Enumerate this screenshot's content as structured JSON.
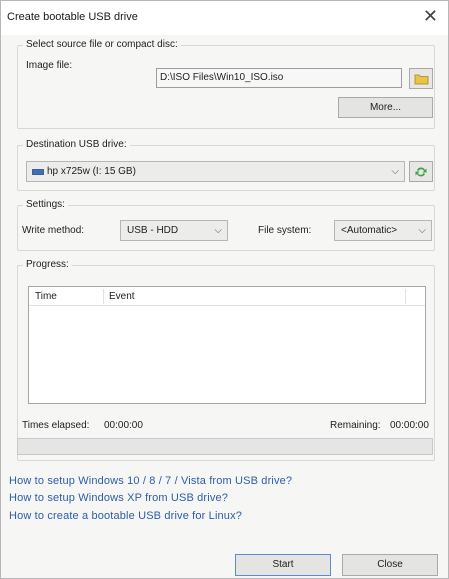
{
  "window": {
    "title": "Create bootable USB drive"
  },
  "source": {
    "legend": "Select source file or compact disc:",
    "image_label": "Image file:",
    "image_path": "D:\\ISO Files\\Win10_ISO.iso",
    "more_label": "More..."
  },
  "destination": {
    "legend": "Destination USB drive:",
    "drive": "hp x725w (I: 15 GB)"
  },
  "settings": {
    "legend": "Settings:",
    "write_method_label": "Write method:",
    "write_method_value": "USB - HDD",
    "file_system_label": "File system:",
    "file_system_value": "<Automatic>"
  },
  "progress": {
    "legend": "Progress:",
    "columns": [
      "Time",
      "Event"
    ],
    "elapsed_label": "Times elapsed:",
    "elapsed_value": "00:00:00",
    "remaining_label": "Remaining:",
    "remaining_value": "00:00:00",
    "fraction": 0
  },
  "links": [
    "How to setup Windows 10 / 8 / 7 / Vista from USB drive?",
    "How to setup Windows XP from USB drive?",
    "How to create a bootable USB drive for Linux?"
  ],
  "buttons": {
    "start": "Start",
    "close": "Close"
  },
  "colors": {
    "link": "#2d5da8",
    "folder": "#e8c544",
    "refresh": "#3aa546"
  },
  "icons": [
    "close-icon",
    "folder-icon",
    "usb-drive-icon",
    "refresh-icon",
    "chevron-down-icon"
  ]
}
